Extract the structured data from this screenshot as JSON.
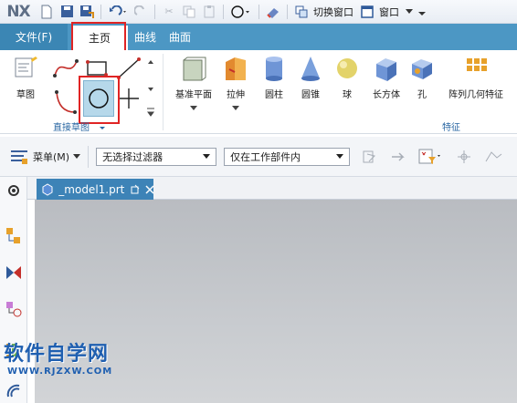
{
  "app": {
    "logo": "NX"
  },
  "quick_access": {
    "switch_window": "切换窗口",
    "window_menu": "窗口"
  },
  "ribbon_tabs": [
    {
      "label": "文件(F)"
    },
    {
      "label": "主页"
    },
    {
      "label": "曲线"
    },
    {
      "label": "曲面"
    }
  ],
  "ribbon": {
    "sketch_label": "草图",
    "direct_sketch_group": "直接草图",
    "feature_group": "特征",
    "buttons": [
      {
        "label": "基准平面"
      },
      {
        "label": "拉伸"
      },
      {
        "label": "圆柱"
      },
      {
        "label": "圆锥"
      },
      {
        "label": "球"
      },
      {
        "label": "长方体"
      },
      {
        "label": "孔"
      },
      {
        "label": "阵列几何特征"
      }
    ]
  },
  "selection_bar": {
    "menu_label": "菜单(M)",
    "filter_value": "无选择过滤器",
    "scope_value": "仅在工作部件内"
  },
  "document": {
    "tab_label": "_model1.prt"
  },
  "watermark": {
    "title": "软件自学网",
    "url": "WWW.RJZXW.COM"
  },
  "colors": {
    "tab_bar": "#4c97c4",
    "highlight": "#e02424",
    "doc_tab": "#3d83b7"
  }
}
